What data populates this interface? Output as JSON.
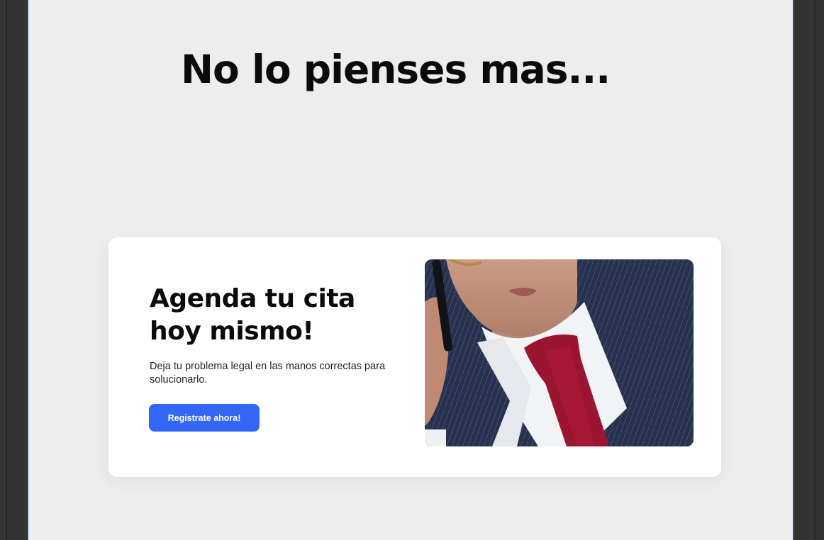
{
  "page": {
    "headline": "No lo pienses mas..."
  },
  "card": {
    "title_line1": "Agenda tu cita",
    "title_line2": "hoy mismo!",
    "description": "Deja tu problema legal en las manos correctas para solucionarlo.",
    "cta_label": "Registrate ahora!"
  },
  "image": {
    "subject": "businessman-on-phone-photo"
  },
  "colors": {
    "canvas_background": "#ededed",
    "card_background": "#ffffff",
    "cta_background": "#3366f5",
    "selection_outline": "#2f6fd6",
    "editor_chrome": "#333333"
  }
}
